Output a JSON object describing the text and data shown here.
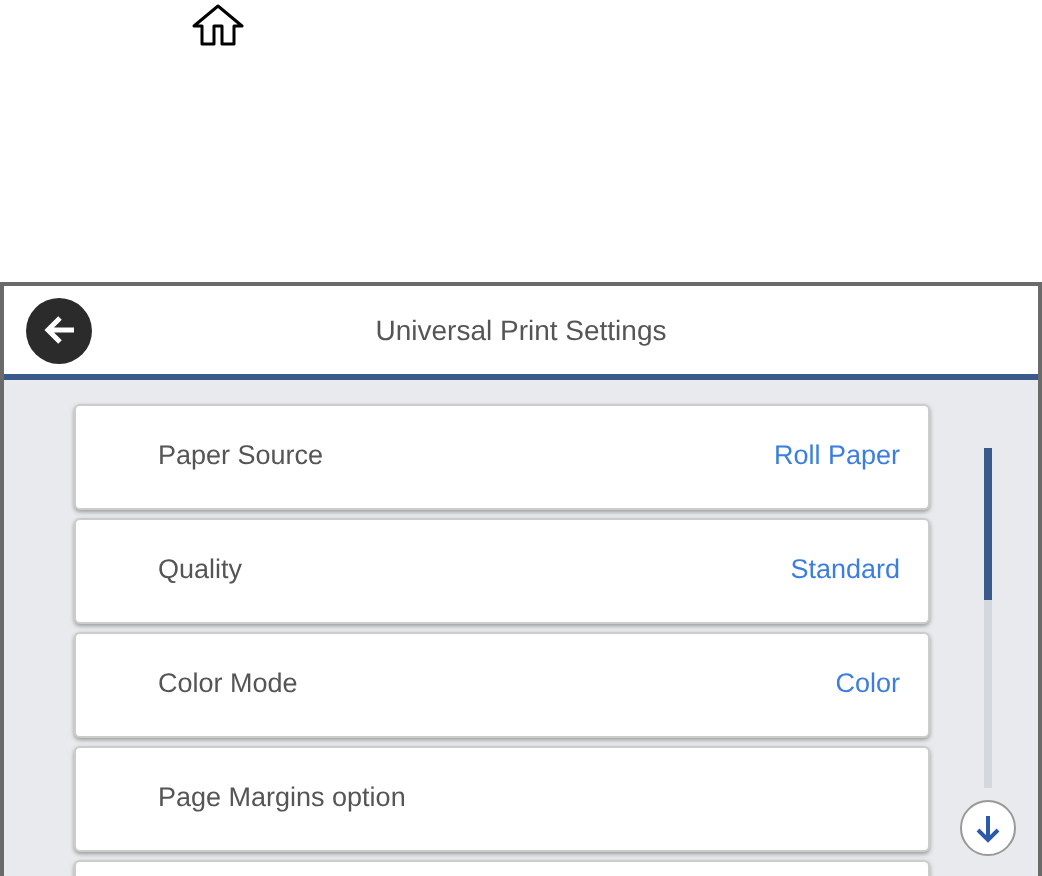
{
  "screen": {
    "title": "Universal Print Settings"
  },
  "settings": [
    {
      "label": "Paper Source",
      "value": "Roll Paper"
    },
    {
      "label": "Quality",
      "value": "Standard"
    },
    {
      "label": "Color Mode",
      "value": "Color"
    },
    {
      "label": "Page Margins option"
    }
  ]
}
